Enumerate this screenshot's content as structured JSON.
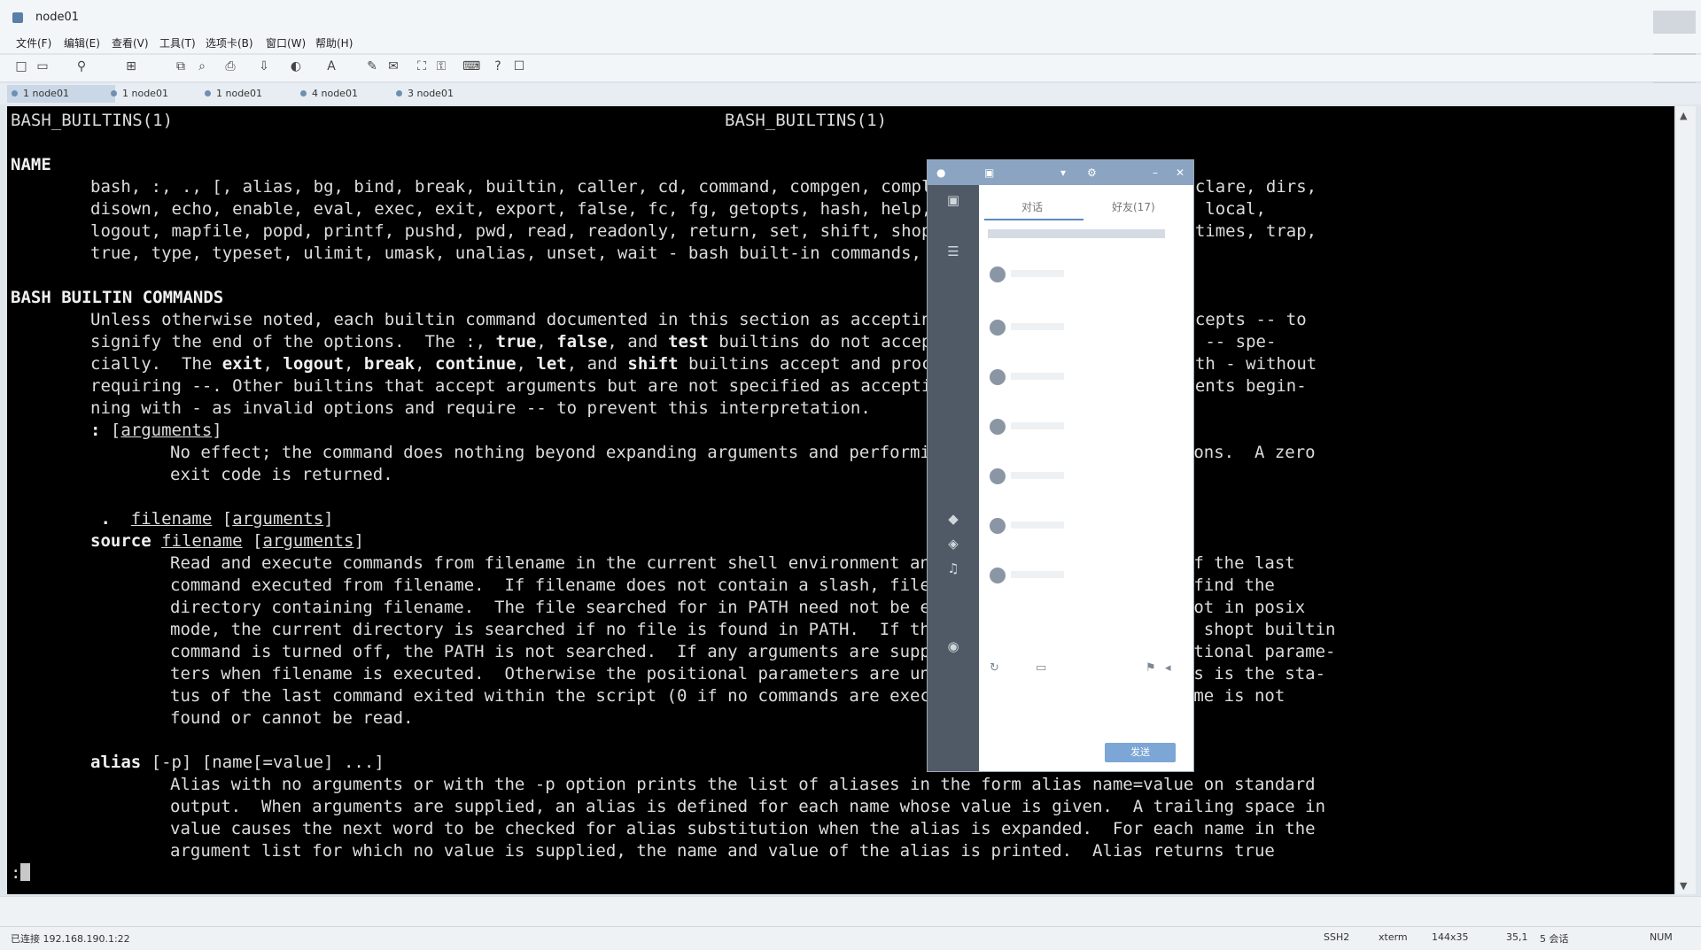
{
  "window": {
    "title": "node01"
  },
  "menu": [
    "文件(F)",
    "编辑(E)",
    "查看(V)",
    "工具(T)",
    "选项卡(B)",
    "窗口(W)",
    "帮助(H)"
  ],
  "tabs": [
    "1 node01",
    "1 node01",
    "1 node01",
    "4 node01",
    "3 node01"
  ],
  "terminal": {
    "header_left": "BASH_BUILTINS(1)",
    "header_center": "BASH_BUILTINS(1)",
    "name_heading": "NAME",
    "name_lines": [
      "bash, :, ., [, alias, bg, bind, break, builtin, caller, cd, command, compgen, complete, compopt, continue, declare, dirs,",
      "disown, echo, enable, eval, exec, exit, export, false, fc, fg, getopts, hash, help, history, jobs, kill, let, local,",
      "logout, mapfile, popd, printf, pushd, pwd, read, readonly, return, set, shift, shopt, source, suspend, test, times, trap,",
      "true, type, typeset, ulimit, umask, unalias, unset, wait - bash built-in commands, see bash(1)"
    ],
    "builtin_heading": "BASH BUILTIN COMMANDS",
    "intro_lines": [
      "Unless otherwise noted, each builtin command documented in this section as accepting options preceded by - accepts -- to",
      "signify the end of the options.",
      "cially.",
      "requiring --. Other builtins that accept arguments but are not specified as accepting options interpret arguments begin-",
      "ning with - as invalid options and require -- to prevent this interpretation."
    ],
    "colon_cmd": ":",
    "colon_arg": "arguments",
    "colon_desc": [
      "No effect; the command does nothing beyond expanding arguments and performing any specified redirections.  A zero",
      "exit code is returned."
    ],
    "dot_cmd": ".",
    "filename": "filename",
    "source_cmd": "source",
    "arguments": "arguments",
    "source_desc": [
      "Read and execute commands from filename in the current shell environment and return the exit status of the last",
      "command executed from filename.  If filename does not contain a slash, filenames in PATH are used to find the",
      "directory containing filename.  The file searched for in PATH need not be executable.  When bash is not in posix",
      "mode, the current directory is searched if no file is found in PATH.  If the sourcepath option to the shopt builtin",
      "command is turned off, the PATH is not searched.  If any arguments are supplied, they become the positional parame-",
      "ters when filename is executed.  Otherwise the positional parameters are unchanged.  The return status is the sta-",
      "tus of the last command exited within the script (0 if no commands are executed), and false if filename is not",
      "found or cannot be read."
    ],
    "alias_cmd": "alias",
    "alias_opts": "[-p] [name[=value] ...]",
    "alias_desc": [
      "Alias with no arguments or with the -p option prints the list of aliases in the form alias name=value on standard",
      "output.  When arguments are supplied, an alias is defined for each name whose value is given.  A trailing space in",
      "value causes the next word to be checked for alias substitution when the alias is expanded.  For each name in the",
      "argument list for which no value is supplied, the name and value of the alias is printed.  Alias returns true"
    ],
    "prompt": ":"
  },
  "panel": {
    "tab_left": "对话",
    "tab_right": "好友(17)",
    "status": "发送"
  },
  "status": {
    "connection": "已连接 192.168.190.1:22",
    "protocol": "SSH2",
    "term": "xterm",
    "size": "144x35",
    "pos": "35,1",
    "sessions": "5 会话",
    "num": "NUM"
  }
}
